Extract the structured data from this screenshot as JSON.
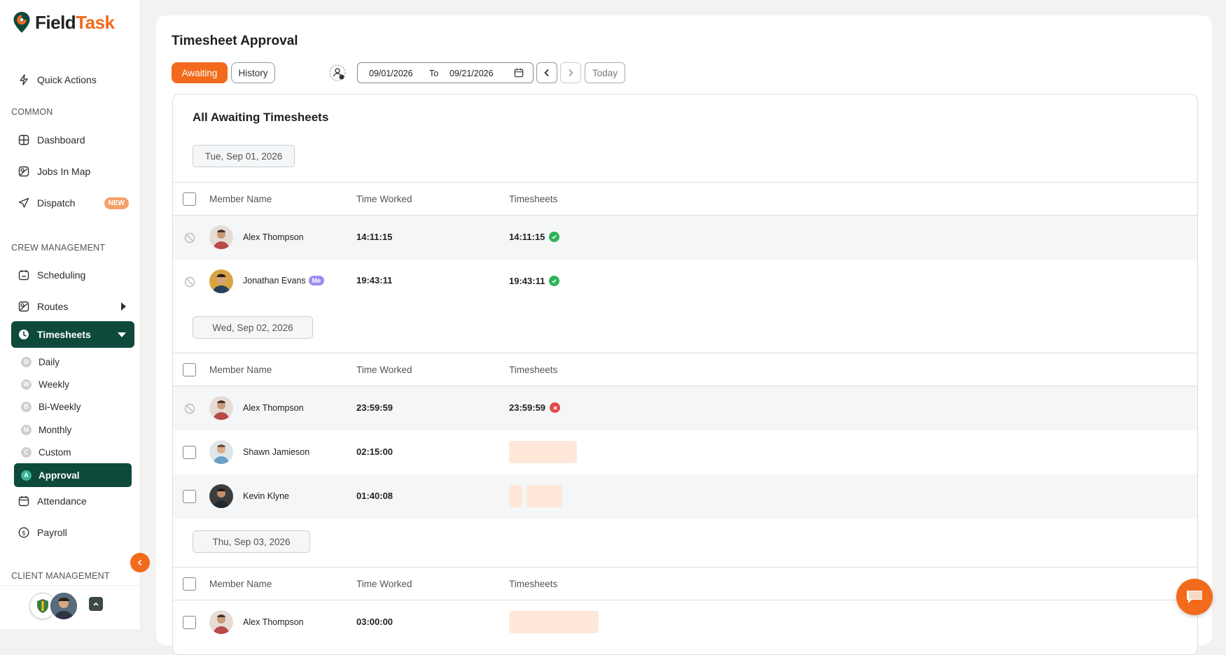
{
  "app": {
    "logo_field": "Field",
    "logo_task": "Task"
  },
  "sidebar": {
    "quick_actions": "Quick Actions",
    "section_common": "COMMON",
    "dashboard": "Dashboard",
    "jobs_in_map": "Jobs In Map",
    "dispatch": "Dispatch",
    "dispatch_badge": "NEW",
    "section_crew": "CREW MANAGEMENT",
    "scheduling": "Scheduling",
    "routes": "Routes",
    "timesheets": "Timesheets",
    "sub_items": [
      {
        "letter": "D",
        "label": "Daily"
      },
      {
        "letter": "W",
        "label": "Weekly"
      },
      {
        "letter": "B",
        "label": "Bi-Weekly"
      },
      {
        "letter": "M",
        "label": "Monthly"
      },
      {
        "letter": "C",
        "label": "Custom"
      },
      {
        "letter": "A",
        "label": "Approval"
      }
    ],
    "attendance": "Attendance",
    "payroll": "Payroll",
    "section_client": "CLIENT MANAGEMENT"
  },
  "header": {
    "title": "Timesheet Approval",
    "tab_awaiting": "Awaiting",
    "tab_history": "History",
    "date_from": "09/01/2026",
    "date_to_label": "To",
    "date_to": "09/21/2026",
    "today": "Today"
  },
  "card": {
    "title": "All Awaiting Timesheets",
    "columns": {
      "member": "Member Name",
      "time": "Time Worked",
      "timesheets": "Timesheets"
    },
    "groups": [
      {
        "date": "Tue, Sep 01, 2026",
        "rows": [
          {
            "name": "Alex Thompson",
            "time": "14:11:15",
            "timesheet": "14:11:15",
            "status": "approved"
          },
          {
            "name": "Jonathan Evans",
            "me": "Me",
            "time": "19:43:11",
            "timesheet": "19:43:11",
            "status": "approved"
          }
        ]
      },
      {
        "date": "Wed, Sep 02, 2026",
        "rows": [
          {
            "name": "Alex Thompson",
            "time": "23:59:59",
            "timesheet": "23:59:59",
            "status": "rejected"
          },
          {
            "name": "Shawn Jamieson",
            "time": "02:15:00"
          },
          {
            "name": "Kevin Klyne",
            "time": "01:40:08"
          }
        ]
      },
      {
        "date": "Thu, Sep 03, 2026",
        "rows": [
          {
            "name": "Alex Thompson",
            "time": "03:00:00"
          }
        ]
      }
    ]
  },
  "colors": {
    "accent": "#f26a1b",
    "nav_active": "#0e4a3c",
    "approved": "#2fb35a",
    "rejected": "#e04b4b"
  }
}
